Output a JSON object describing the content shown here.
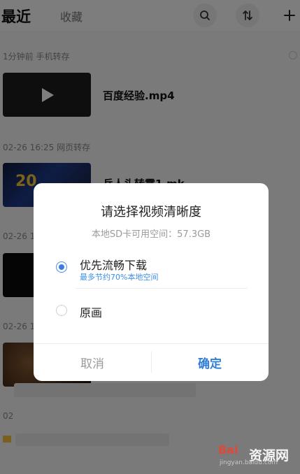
{
  "header": {
    "tabs": [
      "最近",
      "收藏"
    ],
    "icons": [
      "search-icon",
      "sort-icon",
      "add-icon"
    ]
  },
  "sections": [
    {
      "label": "1分钟前  手机转存",
      "item": {
        "name": "百度经验.mp4"
      }
    },
    {
      "label": "02-26 16:25  网页转存",
      "item": {
        "name": "兵人头转露1.mk"
      }
    },
    {
      "label": "02-26 1",
      "item": {
        "name": ""
      }
    },
    {
      "label": "02-26 1",
      "item": {
        "name": ""
      }
    },
    {
      "label": "02",
      "item": {
        "name": ""
      }
    }
  ],
  "dialog": {
    "title": "请选择视频清晰度",
    "storage": "本地SD卡可用空间：57.3GB",
    "options": [
      {
        "label": "优先流畅下载",
        "hint": "最多节约70%本地空间",
        "selected": true
      },
      {
        "label": "原画",
        "hint": "",
        "selected": false
      }
    ],
    "cancel": "取消",
    "confirm": "确定",
    "accent_color": "#2f7fd6"
  },
  "watermark": {
    "logo": "Bai",
    "text": "资源网",
    "url": "jingyan.baidu.com"
  }
}
